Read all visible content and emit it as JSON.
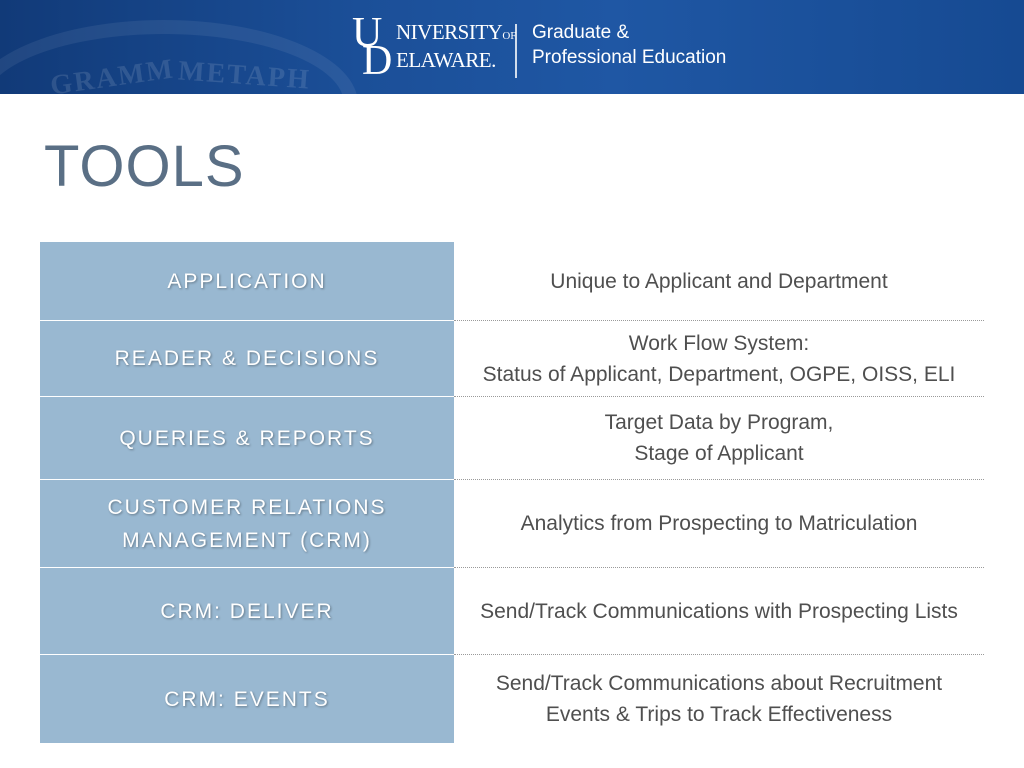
{
  "header": {
    "university_line1": "NIVERSITY",
    "university_of": "OF",
    "university_line2": "ELAWARE.",
    "logo_letter_u": "U",
    "logo_letter_d": "D",
    "department_line1": "Graduate &",
    "department_line2": "Professional Education",
    "background_words": [
      "GRAMM",
      "METAPH"
    ],
    "brand_color": "#1b4f98"
  },
  "title": "TOOLS",
  "rows": [
    {
      "label": [
        "APPLICATION"
      ],
      "desc": [
        "Unique to Applicant and Department"
      ]
    },
    {
      "label": [
        "READER & DECISIONS"
      ],
      "desc": [
        "Work Flow System:",
        "Status of Applicant, Department, OGPE, OISS, ELI"
      ]
    },
    {
      "label": [
        "QUERIES & REPORTS"
      ],
      "desc": [
        "Target Data by Program,",
        "Stage of Applicant"
      ]
    },
    {
      "label": [
        "CUSTOMER RELATIONS",
        "MANAGEMENT (CRM)"
      ],
      "desc": [
        "Analytics from Prospecting to Matriculation"
      ]
    },
    {
      "label": [
        "CRM: DELIVER"
      ],
      "desc": [
        "Send/Track Communications with Prospecting Lists"
      ]
    },
    {
      "label": [
        "CRM: EVENTS"
      ],
      "desc": [
        "Send/Track Communications about Recruitment",
        "Events & Trips to Track Effectiveness"
      ]
    }
  ],
  "colors": {
    "label_fill": "#99b8d1",
    "title_text": "#5a6f85",
    "body_text": "#4f4f4f"
  }
}
